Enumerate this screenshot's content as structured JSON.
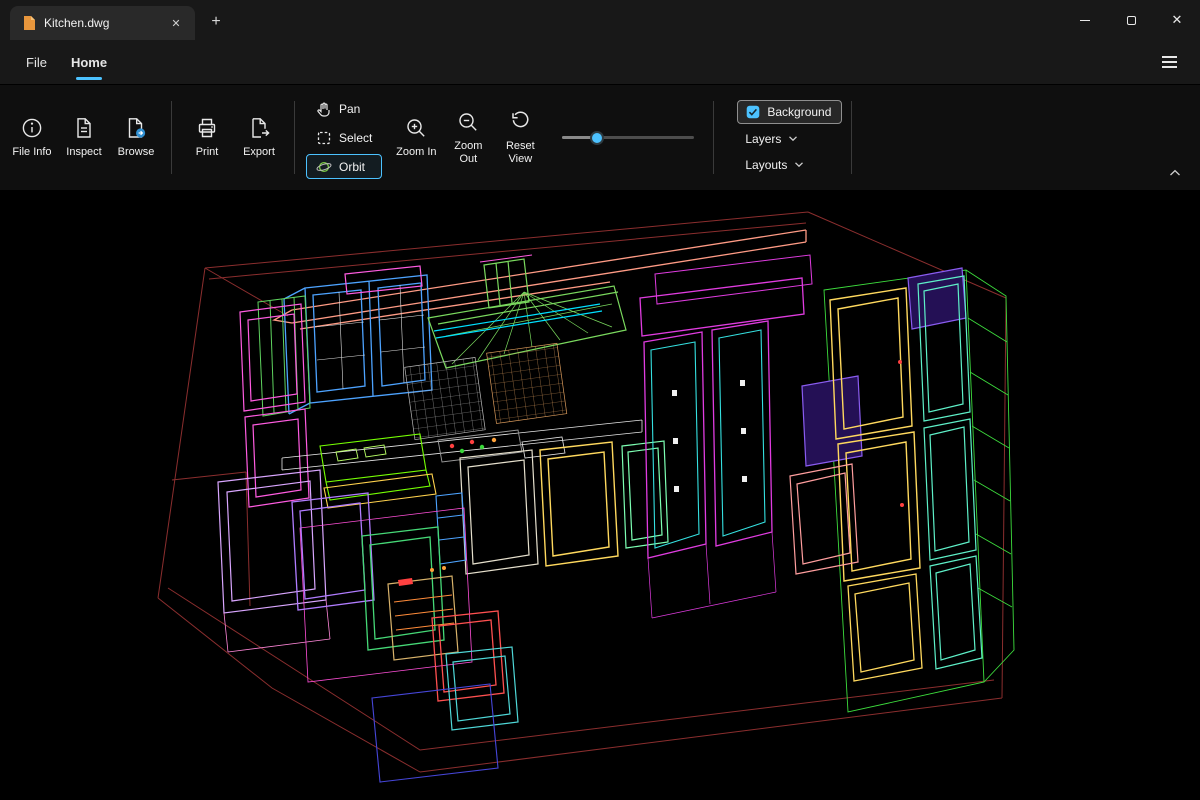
{
  "window": {
    "tabs": [
      {
        "title": "Kitchen.dwg"
      }
    ],
    "icons": {
      "close": "✕",
      "new_tab": "+",
      "tab_close": "✕"
    }
  },
  "menu": {
    "items": [
      {
        "label": "File",
        "active": false
      },
      {
        "label": "Home",
        "active": true
      }
    ]
  },
  "ribbon": {
    "file_group": [
      {
        "label": "File Info"
      },
      {
        "label": "Inspect"
      },
      {
        "label": "Browse"
      }
    ],
    "output_group": [
      {
        "label": "Print"
      },
      {
        "label": "Export"
      }
    ],
    "nav_group": [
      {
        "label": "Pan",
        "active": false
      },
      {
        "label": "Select",
        "active": false
      },
      {
        "label": "Orbit",
        "active": true
      }
    ],
    "zoom_group": [
      {
        "label": "Zoom In"
      },
      {
        "label": "Zoom Out"
      },
      {
        "label": "Reset View"
      }
    ],
    "slider": {
      "value_pct": 26
    },
    "panel_group": {
      "background": "Background",
      "layers": "Layers",
      "layouts": "Layouts"
    }
  },
  "canvas": {
    "drawing": "kitchen-3d-wireframe",
    "background": "#000000",
    "palette": {
      "room_outline": "#8b2e2e",
      "soffit_salmon": "#ff9b85",
      "cabinet_blue": "#4da3ff",
      "hood_green": "#7ad95e",
      "accent_cyan": "#00e0ff",
      "magenta": "#e03ce0",
      "pink": "#ff5ce1",
      "yellow": "#ffd95e",
      "teal": "#5ef0c8",
      "salmon": "#ff9e9e",
      "violet": "#8a5cf0",
      "green": "#46d977",
      "red": "#ff5050",
      "orange": "#ff8c3a",
      "lavender": "#d9a6ff",
      "navy": "#4646d9"
    }
  }
}
